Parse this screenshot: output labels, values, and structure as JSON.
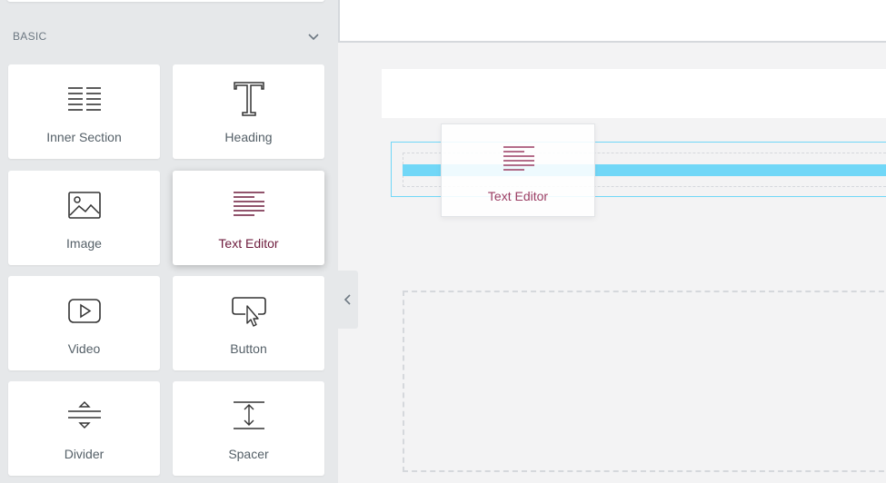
{
  "panel": {
    "category": {
      "title": "BASIC",
      "icon": "chevron-down-icon"
    },
    "widgets": [
      {
        "label": "Inner Section",
        "icon": "inner-section-icon"
      },
      {
        "label": "Heading",
        "icon": "heading-icon"
      },
      {
        "label": "Image",
        "icon": "image-icon"
      },
      {
        "label": "Text Editor",
        "icon": "text-editor-icon",
        "active": true
      },
      {
        "label": "Video",
        "icon": "video-icon"
      },
      {
        "label": "Button",
        "icon": "button-icon"
      },
      {
        "label": "Divider",
        "icon": "divider-icon"
      },
      {
        "label": "Spacer",
        "icon": "spacer-icon"
      }
    ],
    "collapse_icon": "chevron-left-icon"
  },
  "canvas": {
    "dragged_widget": {
      "label": "Text Editor",
      "icon": "text-editor-icon"
    }
  },
  "colors": {
    "accent": "#6d1b3c",
    "drop_indicator": "#71d7f7",
    "panel_bg": "#e6e8ea"
  }
}
